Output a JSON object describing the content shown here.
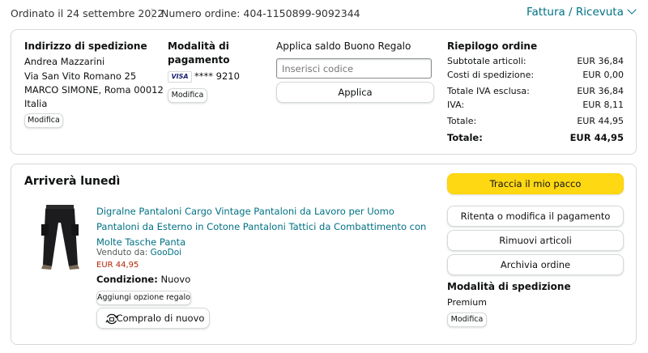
{
  "header": {
    "order_date": "Ordinato il 24 settembre 2022",
    "order_number": "Numero ordine: 404-1150899-9092344",
    "invoice_link": "Fattura / Ricevuta"
  },
  "shipping": {
    "heading": "Indirizzo di spedizione",
    "lines": [
      "Andrea Mazzarini",
      "Via San Vito Romano 25",
      "MARCO SIMONE, Roma 00012",
      "Italia"
    ],
    "edit_label": "Modifica"
  },
  "payment": {
    "heading_line1": "Modalità di",
    "heading_line2": "pagamento",
    "card_brand": "VISA",
    "card_number": "**** 9210",
    "edit_label": "Modifica"
  },
  "gift_card": {
    "heading": "Applica saldo Buono Regalo",
    "input_placeholder": "Inserisci codice",
    "apply_label": "Applica"
  },
  "summary": {
    "heading": "Riepilogo ordine",
    "rows": [
      {
        "label": "Subtotale articoli:",
        "value": "EUR 36,84"
      },
      {
        "label": "Costi di spedizione:",
        "value": "EUR 0,00"
      },
      {
        "label": "Totale IVA esclusa:",
        "value": "EUR 36,84"
      },
      {
        "label": "IVA:",
        "value": "EUR 8,11"
      },
      {
        "label": "Totale:",
        "value": "EUR 44,95"
      },
      {
        "label": "Totale:",
        "value": "EUR 44,95"
      }
    ]
  },
  "shipment": {
    "heading": "Arriverà lunedì",
    "product": {
      "title": "Digralne Pantaloni Cargo Vintage Pantaloni da Lavoro per Uomo Pantaloni da Esterno in Cotone Pantaloni Tattici da Combattimento con Molte Tasche Panta",
      "sold_by_label": "Venduto da:",
      "seller": "GooDoi",
      "price": "EUR 44,95",
      "condition_label": "Condizione:",
      "condition_value": "Nuovo",
      "gift_option_label": "Aggiungi opzione regalo",
      "buy_again_label": "Compralo di nuovo"
    },
    "actions": {
      "track": "Traccia il mio pacco",
      "retry_payment": "Ritenta o modifica il pagamento",
      "remove_items": "Rimuovi articoli",
      "archive": "Archivia ordine"
    },
    "shipping_method": {
      "heading": "Modalità di spedizione",
      "value": "Premium",
      "edit_label": "Modifica"
    }
  },
  "colors": {
    "link": "#007185",
    "price": "#b12704",
    "primary_button": "#ffd814",
    "border": "#d5d9d9"
  }
}
